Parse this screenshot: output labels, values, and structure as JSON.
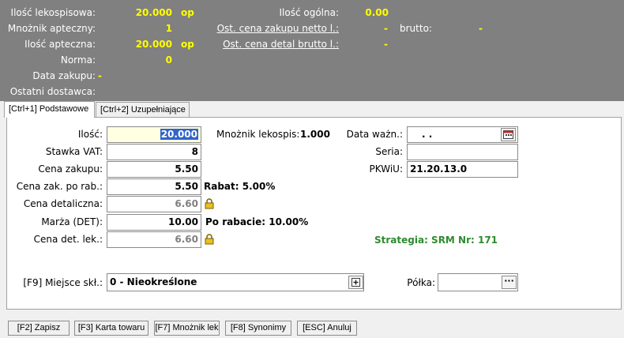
{
  "header": {
    "ilosc_lekospisowa_label": "Ilość lekospisowa:",
    "ilosc_lekospisowa_value": "20.000",
    "ilosc_lekospisowa_unit": "op",
    "mnoznik_apteczny_label": "Mnożnik apteczny:",
    "mnoznik_apteczny_value": "1",
    "ilosc_apteczna_label": "Ilość apteczna:",
    "ilosc_apteczna_value": "20.000",
    "ilosc_apteczna_unit": "op",
    "norma_label": "Norma:",
    "norma_value": "0",
    "data_zakupu_label": "Data zakupu:",
    "data_zakupu_value": "-",
    "ostatni_dostawca_label": "Ostatni dostawca:",
    "ilosc_ogolna_label": "Ilość ogólna:",
    "ilosc_ogolna_value": "0.00",
    "ost_cena_zakupu_label": "Ost. cena zakupu netto l.:",
    "ost_cena_zakupu_value": "-",
    "brutto_label": "brutto:",
    "brutto_value": "-",
    "ost_cena_detal_label": "Ost. cena detal brutto l.:",
    "ost_cena_detal_value": "-"
  },
  "tabs": [
    {
      "label": "[Ctrl+1] Podstawowe",
      "active": true
    },
    {
      "label": "[Ctrl+2] Uzupełniające",
      "active": false
    }
  ],
  "form": {
    "ilosc_label": "Ilość:",
    "ilosc_value": "20.000",
    "stawka_vat_label": "Stawka VAT:",
    "stawka_vat_value": "8",
    "cena_zakupu_label": "Cena zakupu:",
    "cena_zakupu_value": "5.50",
    "cena_zak_po_rab_label": "Cena zak. po rab.:",
    "cena_zak_po_rab_value": "5.50",
    "rabat_text": "Rabat: 5.00%",
    "cena_detaliczna_label": "Cena detaliczna:",
    "cena_detaliczna_value": "6.60",
    "marza_label": "Marża (DET):",
    "marza_value": "10.00",
    "po_rabacie_text": "Po rabacie: 10.00%",
    "cena_det_lek_label": "Cena det. lek.:",
    "cena_det_lek_value": "6.60",
    "mnoznik_lekospis_label": "Mnożnik lekospis:",
    "mnoznik_lekospis_value": "1.000",
    "data_wazn_label": "Data ważn.:",
    "data_wazn_value": ". .",
    "seria_label": "Seria:",
    "seria_value": "",
    "pkwiu_label": "PKWiU:",
    "pkwiu_value": "21.20.13.0",
    "strategia_text": "Strategia: SRM Nr: 171",
    "miejsce_skl_label": "[F9] Miejsce skł.:",
    "miejsce_skl_value": "0 - Nieokreślone",
    "polka_label": "Półka:",
    "polka_value": "",
    "more_button_text": "···"
  },
  "buttons": {
    "zapisz": "[F2] Zapisz",
    "karta_towaru": "[F3] Karta towaru",
    "mnoznik_lek": "[F7] Mnożnik lek",
    "synonimy": "[F8] Synonimy",
    "anuluj": "[ESC] Anuluj"
  },
  "colors": {
    "header_bg": "#808080",
    "header_value": "#ffff00",
    "strategy": "#2e8b2e",
    "selection": "#3064c8",
    "qty_field_bg": "#ffffe1"
  },
  "icons": {
    "lock": "lock-icon",
    "calendar": "calendar-icon",
    "add": "plus-icon",
    "more": "ellipsis-icon"
  }
}
